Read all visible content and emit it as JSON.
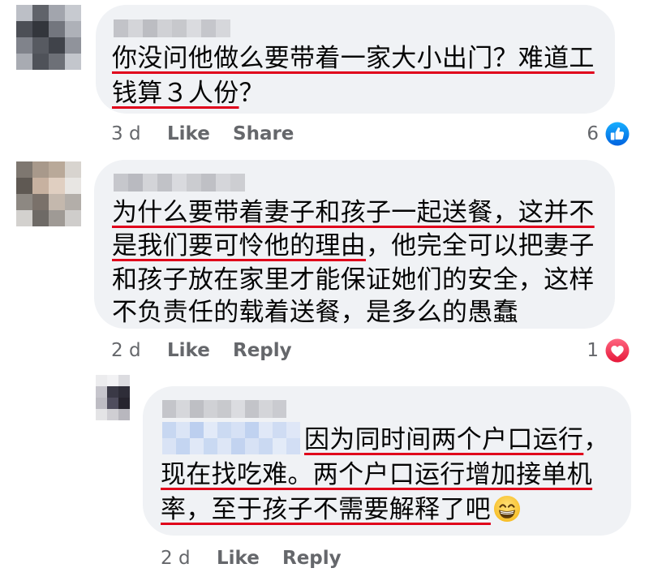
{
  "comments": [
    {
      "lines": [
        [
          "你没问他做么要带着一家大小出门？难道工"
        ],
        [
          "钱算３人份",
          "？"
        ]
      ],
      "time": "3 d",
      "like_label": "Like",
      "second_action_label": "Share",
      "reaction": {
        "count": "6",
        "icon": "like-reaction-icon",
        "color": "#1877f2"
      }
    },
    {
      "lines": [
        [
          "为什么要带着妻子和孩子一起送餐，这并不"
        ],
        [
          "是我们要可怜他的理由",
          "，他完全可以把妻子"
        ],
        [
          "和孩子放在家里才能保证她们的安全，这样"
        ],
        [
          "不负责任的载着送餐，是多么的愚蠢"
        ]
      ],
      "time": "2 d",
      "like_label": "Like",
      "second_action_label": "Reply",
      "reaction": {
        "count": "1",
        "icon": "love-reaction-icon",
        "color": "#f33e58"
      }
    }
  ],
  "reply": {
    "lines": [
      [
        "因为同时间两个户口运行",
        "，"
      ],
      [
        "现在找吃难。两个户口运行增加接单机"
      ],
      [
        "率，至于孩子不需要解释了吧"
      ]
    ],
    "emoji_icon": "beaming-face-with-smiling-eyes-icon",
    "time": "2 d",
    "like_label": "Like",
    "reply_label": "Reply"
  },
  "theme": {
    "bubble": "#f0f2f5",
    "text": "#050505",
    "meta_text": "#65676b",
    "highlight_underline": "#e0001b"
  }
}
